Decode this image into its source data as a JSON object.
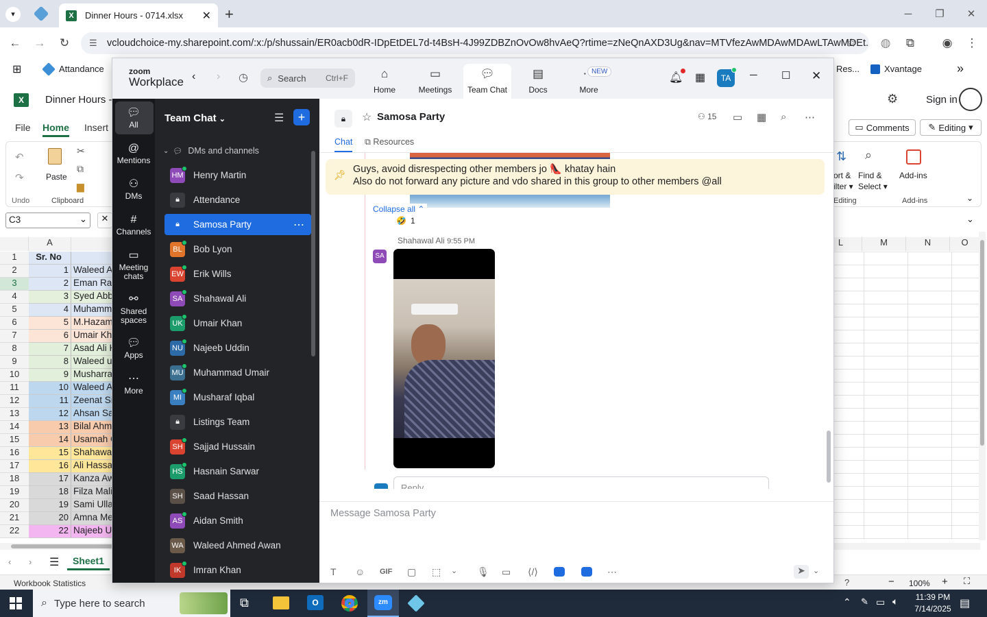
{
  "browser": {
    "tab_title": "Dinner Hours - 0714.xlsx",
    "url": "vcloudchoice-my.sharepoint.com/:x:/p/shussain/ER0acb0dR-IDpEtDEL7d-t4BsH-4J99ZDBZnOvOw8hvAeQ?rtime=zNeQnAXD3Ug&nav=MTVfezAwMDAwMDAwLTAwMDEt...",
    "bookmarks": [
      "Attandance",
      "Res...",
      "Xvantage"
    ]
  },
  "excel": {
    "title": "Dinner Hours -",
    "tabs": [
      "File",
      "Home",
      "Insert"
    ],
    "name_box": "C3",
    "ribbon": {
      "paste": "Paste",
      "clipboard": "Clipboard",
      "undo": "Undo",
      "sort": "ort &",
      "sort2": "ilter",
      "find": "Find &",
      "find2": "Select",
      "editing": "Editing",
      "addins": "Add-ins",
      "addins_group": "Add-ins"
    },
    "comments": "Comments",
    "editing_mode": "Editing",
    "signin": "Sign in",
    "col_a": "A",
    "cols_right": [
      "L",
      "M",
      "N",
      "O"
    ],
    "header_row": "Sr. No",
    "rows": [
      {
        "n": "2",
        "a": "1",
        "b": "Waleed A",
        "c": "#dce6f4"
      },
      {
        "n": "3",
        "a": "2",
        "b": "Eman Rau",
        "c": "#dce6f4"
      },
      {
        "n": "4",
        "a": "3",
        "b": "Syed Abb",
        "c": "#e4efdc"
      },
      {
        "n": "5",
        "a": "4",
        "b": "Muhamm",
        "c": "#dce6f4"
      },
      {
        "n": "6",
        "a": "5",
        "b": "M.Hazam",
        "c": "#fce4d6"
      },
      {
        "n": "7",
        "a": "6",
        "b": "Umair Kh",
        "c": "#fce4d6"
      },
      {
        "n": "8",
        "a": "7",
        "b": "Asad Ali K",
        "c": "#e2efda"
      },
      {
        "n": "9",
        "a": "8",
        "b": "Waleed u",
        "c": "#e2efda"
      },
      {
        "n": "10",
        "a": "9",
        "b": "Musharra",
        "c": "#e2efda"
      },
      {
        "n": "11",
        "a": "10",
        "b": "Waleed A",
        "c": "#bdd7ee"
      },
      {
        "n": "12",
        "a": "11",
        "b": "Zeenat Si",
        "c": "#bdd7ee"
      },
      {
        "n": "13",
        "a": "12",
        "b": "Ahsan Sa",
        "c": "#bdd7ee"
      },
      {
        "n": "14",
        "a": "13",
        "b": "Bilal Ahm",
        "c": "#f8cbad"
      },
      {
        "n": "15",
        "a": "14",
        "b": "Usamah C",
        "c": "#f8cbad"
      },
      {
        "n": "16",
        "a": "15",
        "b": "Shahawal",
        "c": "#ffe699"
      },
      {
        "n": "17",
        "a": "16",
        "b": "Ali Hassa",
        "c": "#ffe699"
      },
      {
        "n": "18",
        "a": "17",
        "b": "Kanza Aw",
        "c": "#d9d9d9"
      },
      {
        "n": "19",
        "a": "18",
        "b": "Filza Mali",
        "c": "#d9d9d9"
      },
      {
        "n": "20",
        "a": "19",
        "b": "Sami Ulla",
        "c": "#d9d9d9"
      },
      {
        "n": "21",
        "a": "20",
        "b": "Amna Me",
        "c": "#d9d9d9"
      },
      {
        "n": "22",
        "a": "22",
        "b": "Najeeb U",
        "c": "#f4b6f0"
      }
    ],
    "sheet": "Sheet1",
    "status": "Workbook Statistics",
    "zoom": "100%"
  },
  "zoom": {
    "brand_top": "zoom",
    "brand": "Workplace",
    "search": "Search",
    "search_shortcut": "Ctrl+F",
    "tabs": [
      "Home",
      "Meetings",
      "Team Chat",
      "Docs",
      "More"
    ],
    "new_badge": "NEW",
    "avatar": "TA",
    "rail": [
      "All",
      "Mentions",
      "DMs",
      "Channels",
      "Meeting chats",
      "Shared spaces",
      "Apps",
      "More"
    ],
    "list_title": "Team Chat",
    "section": "DMs and channels",
    "channels": [
      {
        "name": "Henry Martin",
        "av": "HM",
        "color": "#8e4bb8",
        "online": true
      },
      {
        "name": "Attendance",
        "av": "lock",
        "color": "#3a3b40",
        "online": false
      },
      {
        "name": "Samosa Party",
        "av": "lock",
        "color": "#1f6be0",
        "online": false
      },
      {
        "name": "Bob Lyon",
        "av": "BL",
        "color": "#e0742a",
        "online": true
      },
      {
        "name": "Erik Wills",
        "av": "EW",
        "color": "#d9432f",
        "online": true
      },
      {
        "name": "Shahawal Ali",
        "av": "SA",
        "color": "#8e4bb8",
        "online": true
      },
      {
        "name": "Umair Khan",
        "av": "UK",
        "color": "#1c9c6a",
        "online": true
      },
      {
        "name": "Najeeb Uddin",
        "av": "NU",
        "color": "#2d6aa8",
        "online": true
      },
      {
        "name": "Muhammad Umair",
        "av": "MU",
        "color": "#3a6f8f",
        "online": true
      },
      {
        "name": "Musharaf Iqbal",
        "av": "MI",
        "color": "#3a7fc0",
        "online": true
      },
      {
        "name": "Listings Team",
        "av": "lock",
        "color": "#3a3b40",
        "online": false
      },
      {
        "name": "Sajjad Hussain",
        "av": "SH",
        "color": "#d9432f",
        "online": true
      },
      {
        "name": "Hasnain Sarwar",
        "av": "HS",
        "color": "#1c9c6a",
        "online": true
      },
      {
        "name": "Saad Hassan",
        "av": "SH",
        "color": "#5a5048",
        "online": false
      },
      {
        "name": "Aidan Smith",
        "av": "AS",
        "color": "#8e4bb8",
        "online": true
      },
      {
        "name": "Waleed Ahmed Awan",
        "av": "WA",
        "color": "#6b5a4a",
        "online": false
      },
      {
        "name": "Imran Khan",
        "av": "IK",
        "color": "#c0392b",
        "online": true
      }
    ],
    "channel_title": "Samosa Party",
    "members": "15",
    "subtabs": [
      "Chat",
      "Resources"
    ],
    "pinned_line1": "Guys, avoid disrespecting other members jo 👠 khatay hain",
    "pinned_line2": "Also do not forward any picture and vdo shared in this group to other members @all",
    "collapse": "Collapse all",
    "reaction_count": "1",
    "reaction_emoji": "🤣",
    "msg_sender": "Shahawal Ali",
    "msg_time": "9:55 PM",
    "sender_av": "SA",
    "reply": "Reply",
    "input_placeholder": "Message Samosa Party"
  },
  "taskbar": {
    "search": "Type here to search",
    "time": "11:39 PM",
    "date": "7/14/2025"
  }
}
